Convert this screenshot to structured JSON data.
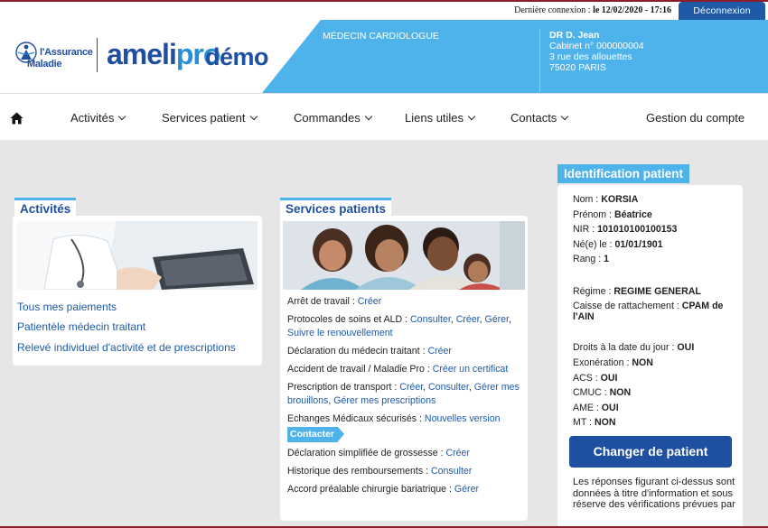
{
  "topbar": {
    "last_connection_label": "Dernière connexion : ",
    "last_connection_value": "le 12/02/2020 - 17:16",
    "logout_label": "Déconnexion"
  },
  "header": {
    "org_line1": "l'Assurance",
    "org_line2": "Maladie",
    "brand_ameli": "ameli",
    "brand_pro": "pro",
    "brand_demo": "démo",
    "specialty": "MÉDECIN CARDIOLOGUE",
    "doctor_name": "DR D. Jean",
    "cabinet": "Cabinet n° 000000004",
    "address1": "3 rue des allouettes",
    "address2": "75020 PARIS"
  },
  "nav": {
    "items": [
      {
        "label": "Activités"
      },
      {
        "label": "Services patient"
      },
      {
        "label": "Commandes"
      },
      {
        "label": "Liens utiles"
      },
      {
        "label": "Contacts"
      },
      {
        "label": "Gestion du compte"
      }
    ]
  },
  "activites": {
    "title": "Activités",
    "links": [
      "Tous mes paiements",
      "Patientèle médecin traitant",
      "Relevé individuel d'activité et de prescriptions"
    ]
  },
  "services": {
    "title": "Services patients",
    "arret_label": "Arrêt de travail : ",
    "arret_creer": "Créer",
    "protocoles_label": "Protocoles de soins et ALD : ",
    "protocoles_consulter": "Consulter",
    "protocoles_creer": "Créer",
    "protocoles_gerer": "Gérer",
    "protocoles_suivre": "Suivre le renouvellement",
    "declaration_label": "Déclaration du médecin traitant : ",
    "declaration_creer": "Créer",
    "accident_label": "Accident de travail / Maladie Pro : ",
    "accident_creer": "Créer un certificat",
    "transport_label": "Prescription de transport : ",
    "transport_creer": "Créer",
    "transport_consulter": "Consulter",
    "transport_brouillons": "Gérer mes brouillons",
    "transport_prescriptions": "Gérer mes prescriptions",
    "echanges_label": "Echanges Médicaux sécurisés : ",
    "echanges_nouvelle": "Nouvelles version",
    "echanges_contacter": "Contacter",
    "grossesse_label": "Déclaration simplifiée de grossesse : ",
    "grossesse_creer": "Créer",
    "historique_label": "Historique des remboursements : ",
    "historique_consulter": "Consulter",
    "accord_label": "Accord préalable chirurgie bariatrique : ",
    "accord_gerer": "Gérer"
  },
  "patient": {
    "title": "Identification patient",
    "nom_label": "Nom : ",
    "nom": "KORSIA",
    "prenom_label": "Prénom : ",
    "prenom": "Béatrice",
    "nir_label": "NIR : ",
    "nir": "101010100100153",
    "ne_label": "Né(e) le : ",
    "ne": "01/01/1901",
    "rang_label": "Rang : ",
    "rang": "1",
    "regime_label": "Régime : ",
    "regime": "REGIME GENERAL",
    "caisse_label": "Caisse de rattachement : ",
    "caisse": "CPAM de l'AIN",
    "droits_label": "Droits à la date du jour : ",
    "droits": "OUI",
    "exo_label": "Exonération : ",
    "exo": "NON",
    "acs_label": "ACS : ",
    "acs": "OUI",
    "cmuc_label": "CMUC : ",
    "cmuc": "NON",
    "ame_label": "AME : ",
    "ame": "OUI",
    "mt_label": "MT : ",
    "mt": "NON",
    "change_button": "Changer de patient",
    "disclaimer": "Les réponses figurant ci-dessus sont données à titre d'information et sous réserve des vérifications prévues par"
  },
  "colors": {
    "brand_blue": "#1f4fa0",
    "light_blue": "#4db3ea",
    "link_blue": "#1f5aa6",
    "accent_red": "#8b1d2c"
  }
}
